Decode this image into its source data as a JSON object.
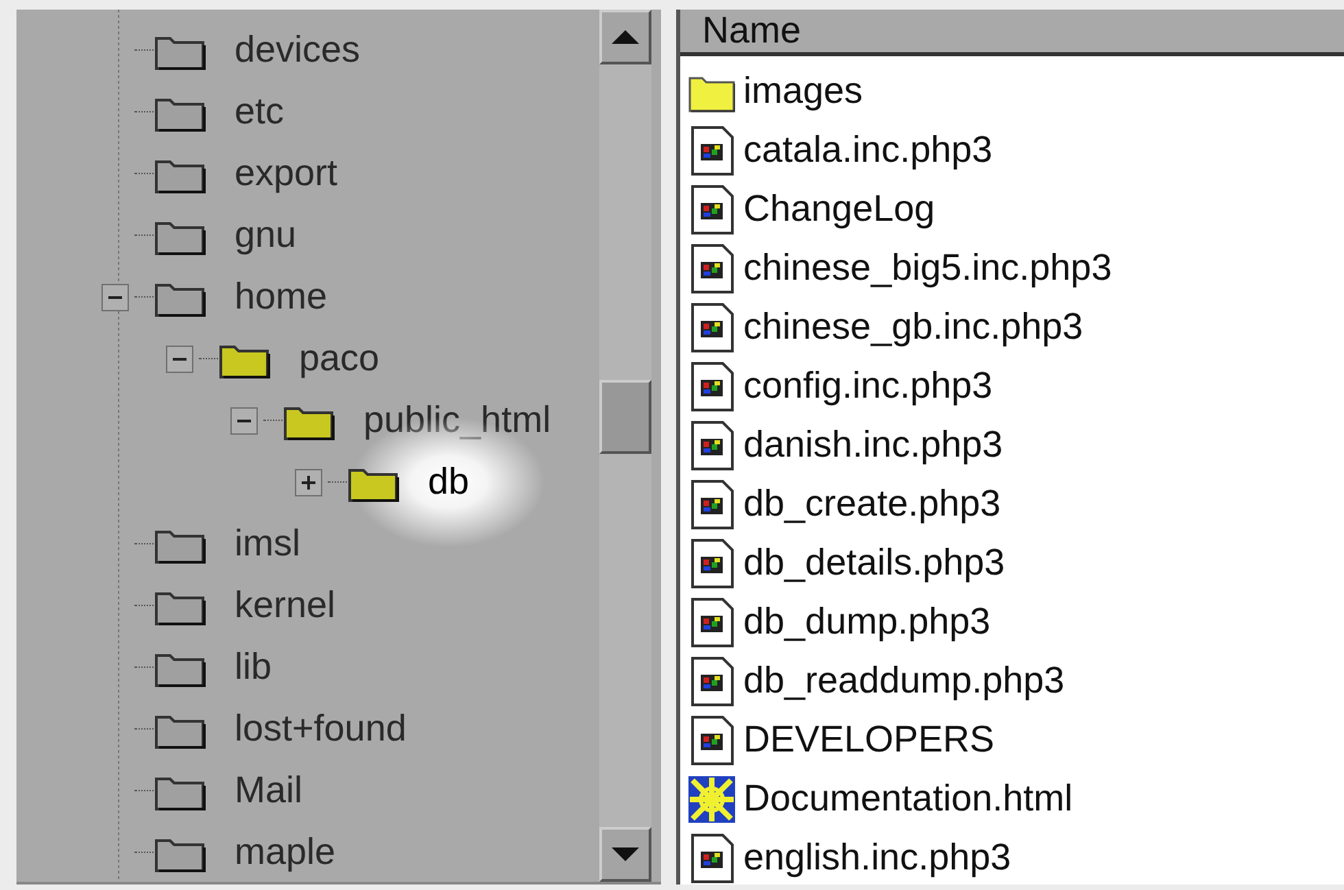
{
  "tree": [
    {
      "label": "devices",
      "kind": "dim",
      "selected": false
    },
    {
      "label": "etc",
      "kind": "dim",
      "selected": false
    },
    {
      "label": "export",
      "kind": "dim",
      "selected": false
    },
    {
      "label": "gnu",
      "kind": "dim",
      "selected": false
    },
    {
      "label": "home",
      "kind": "dim",
      "selected": false,
      "expanded": true,
      "children": [
        {
          "label": "paco",
          "kind": "lit",
          "selected": false,
          "expanded": true,
          "children": [
            {
              "label": "public_html",
              "kind": "lit",
              "selected": false,
              "expanded": true,
              "children": [
                {
                  "label": "db",
                  "kind": "lit",
                  "selected": true,
                  "expanded": false
                }
              ]
            }
          ]
        }
      ]
    },
    {
      "label": "imsl",
      "kind": "dim",
      "selected": false
    },
    {
      "label": "kernel",
      "kind": "dim",
      "selected": false
    },
    {
      "label": "lib",
      "kind": "dim",
      "selected": false
    },
    {
      "label": "lost+found",
      "kind": "dim",
      "selected": false
    },
    {
      "label": "Mail",
      "kind": "dim",
      "selected": false
    },
    {
      "label": "maple",
      "kind": "dim",
      "selected": false
    }
  ],
  "list": {
    "columns": [
      "Name"
    ],
    "rows": [
      {
        "name": "images",
        "kind": "folder"
      },
      {
        "name": "catala.inc.php3",
        "kind": "file"
      },
      {
        "name": "ChangeLog",
        "kind": "file"
      },
      {
        "name": "chinese_big5.inc.php3",
        "kind": "file"
      },
      {
        "name": "chinese_gb.inc.php3",
        "kind": "file"
      },
      {
        "name": "config.inc.php3",
        "kind": "file"
      },
      {
        "name": "danish.inc.php3",
        "kind": "file"
      },
      {
        "name": "db_create.php3",
        "kind": "file"
      },
      {
        "name": "db_details.php3",
        "kind": "file"
      },
      {
        "name": "db_dump.php3",
        "kind": "file"
      },
      {
        "name": "db_readdump.php3",
        "kind": "file"
      },
      {
        "name": "DEVELOPERS",
        "kind": "file"
      },
      {
        "name": "Documentation.html",
        "kind": "html"
      },
      {
        "name": "english.inc.php3",
        "kind": "file"
      }
    ]
  }
}
